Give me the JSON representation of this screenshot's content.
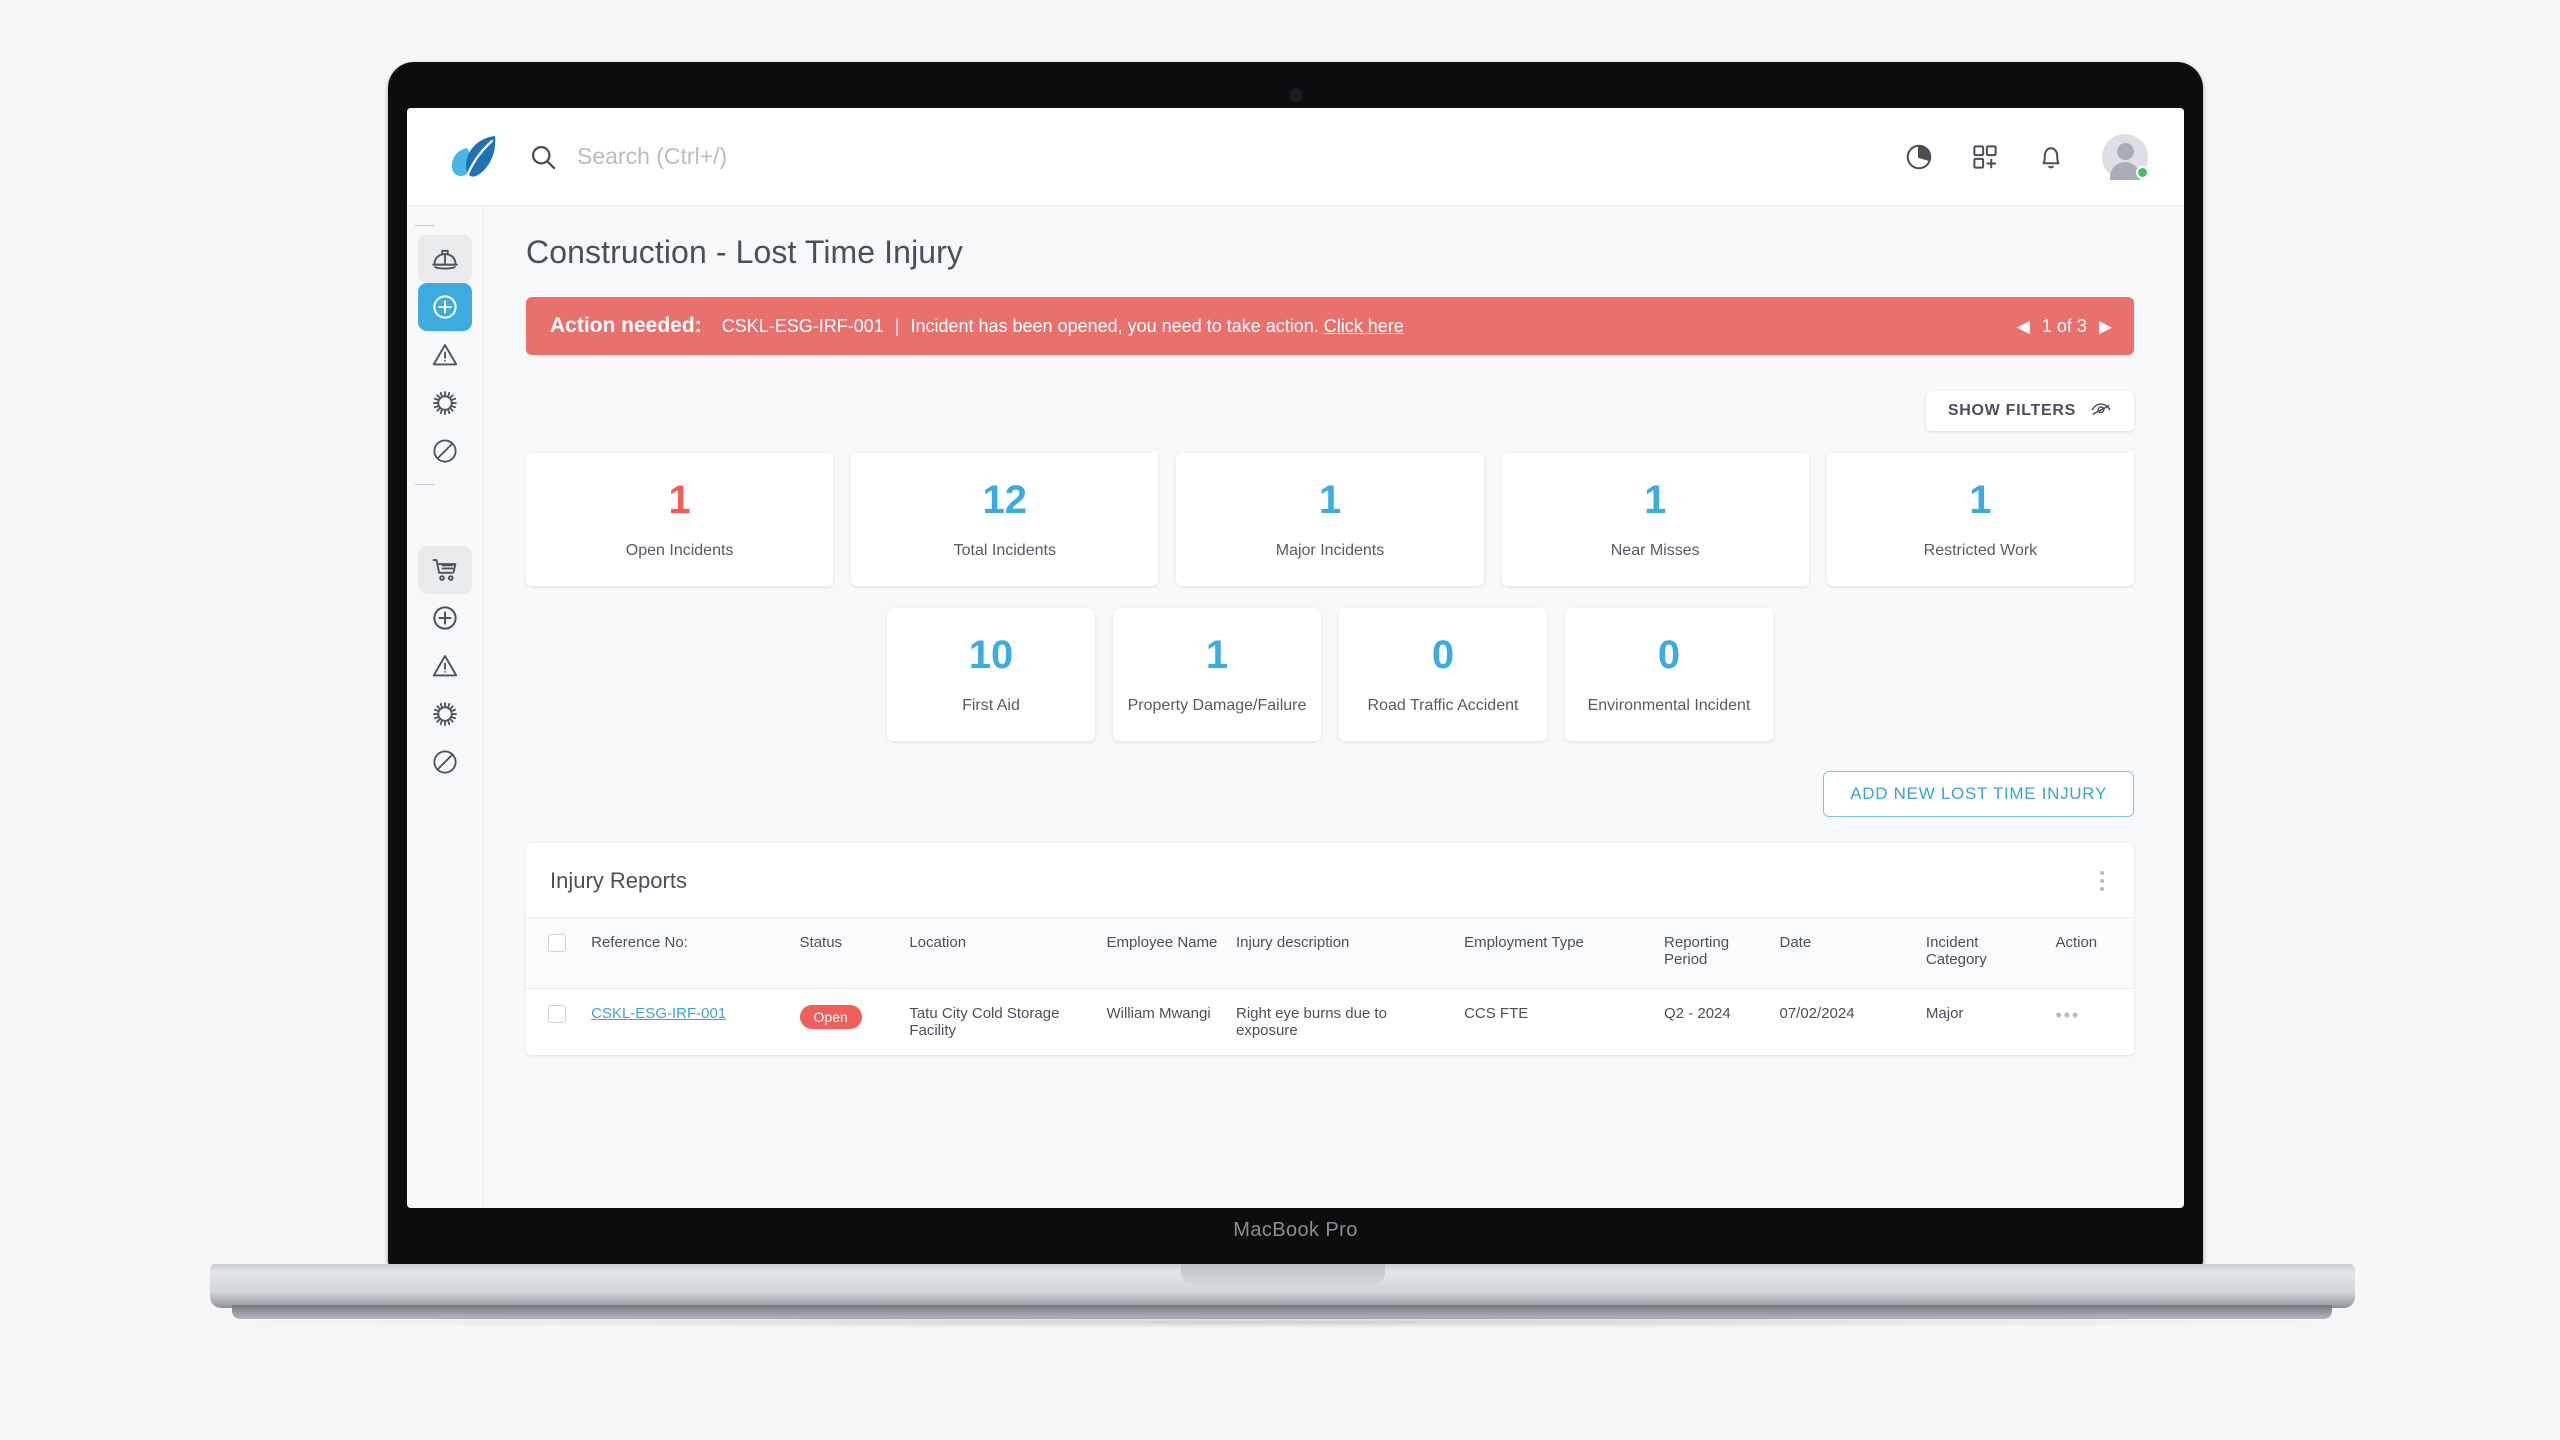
{
  "device": {
    "label": "MacBook Pro"
  },
  "topbar": {
    "logo_name": "leaf-logo",
    "search_placeholder": "Search (Ctrl+/)",
    "search_value": "",
    "icons": [
      {
        "name": "pie-chart-icon",
        "label": "Reports"
      },
      {
        "name": "app-grid-add-icon",
        "label": "Apps"
      },
      {
        "name": "bell-icon",
        "label": "Notifications"
      }
    ],
    "avatar": {
      "name": "avatar",
      "status": "online",
      "status_color": "#43c463"
    }
  },
  "sidebar": {
    "group1": [
      {
        "name": "sidebar-item-hard-hat",
        "icon": "hard-hat-icon",
        "state": "hover"
      },
      {
        "name": "sidebar-item-first-aid",
        "icon": "medical-cross-icon",
        "state": "active"
      },
      {
        "name": "sidebar-item-hazard",
        "icon": "warning-triangle-icon",
        "state": "default"
      },
      {
        "name": "sidebar-item-biohazard",
        "icon": "virus-icon",
        "state": "default"
      },
      {
        "name": "sidebar-item-restricted",
        "icon": "prohibited-icon",
        "state": "default"
      }
    ],
    "group2": [
      {
        "name": "sidebar-item-cart",
        "icon": "shopping-cart-icon",
        "state": "hover"
      },
      {
        "name": "sidebar-item-first-aid-2",
        "icon": "medical-cross-icon",
        "state": "default"
      },
      {
        "name": "sidebar-item-hazard-2",
        "icon": "warning-triangle-icon",
        "state": "default"
      },
      {
        "name": "sidebar-item-biohazard-2",
        "icon": "virus-icon",
        "state": "default"
      },
      {
        "name": "sidebar-item-restricted-2",
        "icon": "prohibited-icon",
        "state": "default"
      }
    ],
    "active_color": "#3cabe0"
  },
  "page": {
    "title": "Construction - Lost Time Injury"
  },
  "alert": {
    "label": "Action needed:",
    "reference": "CSKL-ESG-IRF-001",
    "separator": "|",
    "message": "Incident has been opened, you need to take action.",
    "link_text": "Click here",
    "pager_text": "1 of 3",
    "prev_arrow": "◀",
    "next_arrow": "▶",
    "background": "#e8716e"
  },
  "filters": {
    "label": "SHOW FILTERS",
    "icon": "eye-slash-icon"
  },
  "kpis_row1": [
    {
      "value": "1",
      "label": "Open Incidents",
      "color": "#f15f5c"
    },
    {
      "value": "12",
      "label": "Total Incidents",
      "color": "#3cabe0"
    },
    {
      "value": "1",
      "label": "Major Incidents",
      "color": "#3cabe0"
    },
    {
      "value": "1",
      "label": "Near Misses",
      "color": "#3cabe0"
    },
    {
      "value": "1",
      "label": "Restricted Work",
      "color": "#3cabe0"
    }
  ],
  "kpis_row2": [
    {
      "value": "10",
      "label": "First Aid",
      "color": "#3cabe0"
    },
    {
      "value": "1",
      "label": "Property Damage/Failure",
      "color": "#3cabe0"
    },
    {
      "value": "0",
      "label": "Road Traffic Accident",
      "color": "#3cabe0"
    },
    {
      "value": "0",
      "label": "Environmental Incident",
      "color": "#3cabe0"
    }
  ],
  "add_button": {
    "label": "ADD NEW LOST TIME INJURY"
  },
  "table": {
    "title": "Injury Reports",
    "menu_icon": "kebab-menu-icon",
    "columns": [
      "Reference No:",
      "Status",
      "Location",
      "Employee Name",
      "Injury description",
      "Employment Type",
      "Reporting Period",
      "Date",
      "Incident Category",
      "Action"
    ],
    "rows": [
      {
        "reference": "CSKL-ESG-IRF-001",
        "status": "Open",
        "status_color": "#ef5f5c",
        "location": "Tatu City Cold Storage Facility",
        "employee": "William Mwangi",
        "description": "Right eye burns due to exposure",
        "employment_type": "CCS FTE",
        "reporting_period": "Q2 - 2024",
        "date": "07/02/2024",
        "category": "Major",
        "action_icon": "more-horizontal-icon"
      }
    ]
  }
}
